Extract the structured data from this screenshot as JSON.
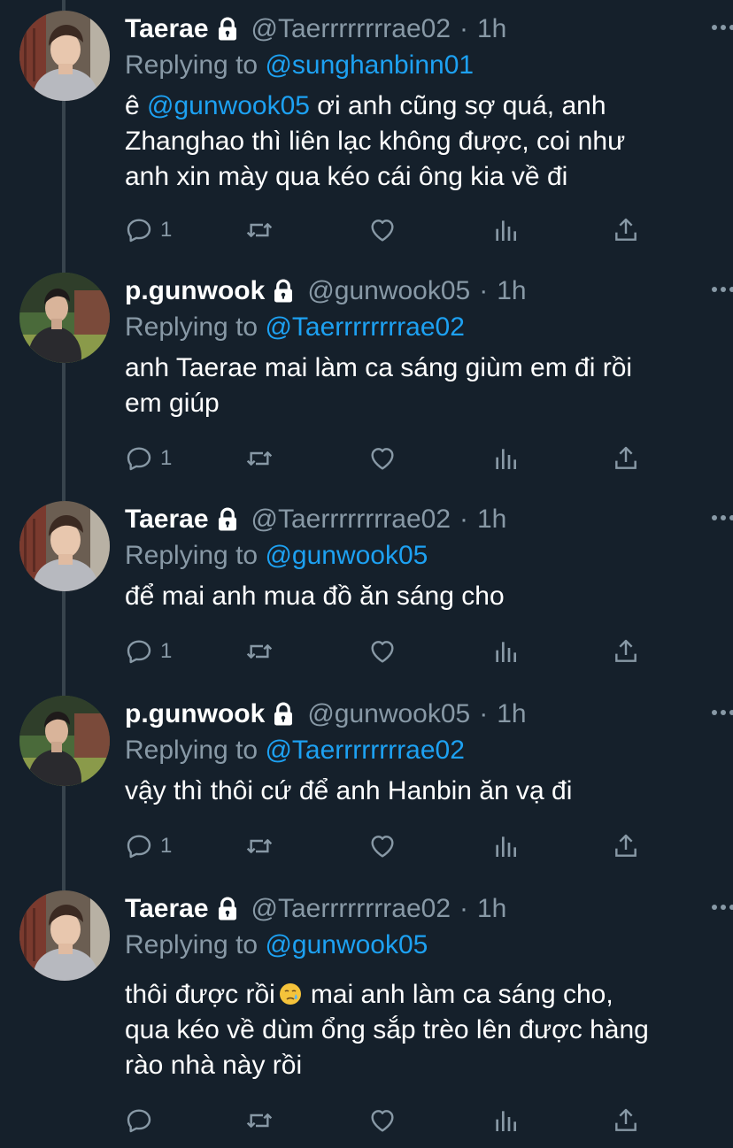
{
  "tweets": [
    {
      "name": "Taerae",
      "handle": "@Taerrrrrrrrae02",
      "time": "1h",
      "replying_prefix": "Replying to ",
      "replying_to": "@sunghanbinn01",
      "text_mention": "@gunwook05",
      "text_line1_after": " ơi anh cũng sợ quá, anh",
      "text_line2": "Zhanghao thì liên lạc không được, coi như",
      "text_line3": "anh xin mày qua kéo cái ông kia về đi",
      "reply_count": "1",
      "avatar": "taerae-avatar"
    },
    {
      "name": "p.gunwook",
      "handle": "@gunwook05",
      "time": "1h",
      "replying_prefix": "Replying to ",
      "replying_to": "@Taerrrrrrrrae02",
      "text_line1": "anh Taerae mai làm ca sáng giùm em đi rồi",
      "text_line2": "em giúp",
      "reply_count": "1",
      "avatar": "gunwook-avatar"
    },
    {
      "name": "Taerae",
      "handle": "@Taerrrrrrrrae02",
      "time": "1h",
      "replying_prefix": "Replying to ",
      "replying_to": "@gunwook05",
      "text_line1": "để mai anh mua đồ ăn sáng cho",
      "reply_count": "1",
      "avatar": "taerae-avatar"
    },
    {
      "name": "p.gunwook",
      "handle": "@gunwook05",
      "time": "1h",
      "replying_prefix": "Replying to ",
      "replying_to": "@Taerrrrrrrrae02",
      "text_line1": "vậy thì thôi cứ để anh Hanbin ăn vạ đi",
      "reply_count": "1",
      "avatar": "gunwook-avatar"
    },
    {
      "name": "Taerae",
      "handle": "@Taerrrrrrrrae02",
      "time": "1h",
      "replying_prefix": "Replying to ",
      "replying_to": "@gunwook05",
      "text_line1_before": "thôi được rồi",
      "text_emoji": "crying-face-emoji",
      "text_line1_after": "mai anh làm ca sáng cho,",
      "text_line2": "qua kéo về dùm ổng sắp trèo lên được hàng",
      "text_line3": "rào nhà này rồi",
      "reply_count": "",
      "avatar": "taerae-avatar"
    }
  ],
  "separator": "·",
  "icons": {
    "lock": "lock-icon",
    "more": "more-icon",
    "reply": "reply-icon",
    "retweet": "retweet-icon",
    "like": "heart-icon",
    "analytics": "analytics-icon",
    "share": "share-icon"
  },
  "colors": {
    "background": "#15202b",
    "text": "#ffffff",
    "muted": "#8899a6",
    "link": "#1da1f2",
    "thread_line": "#38444d"
  }
}
